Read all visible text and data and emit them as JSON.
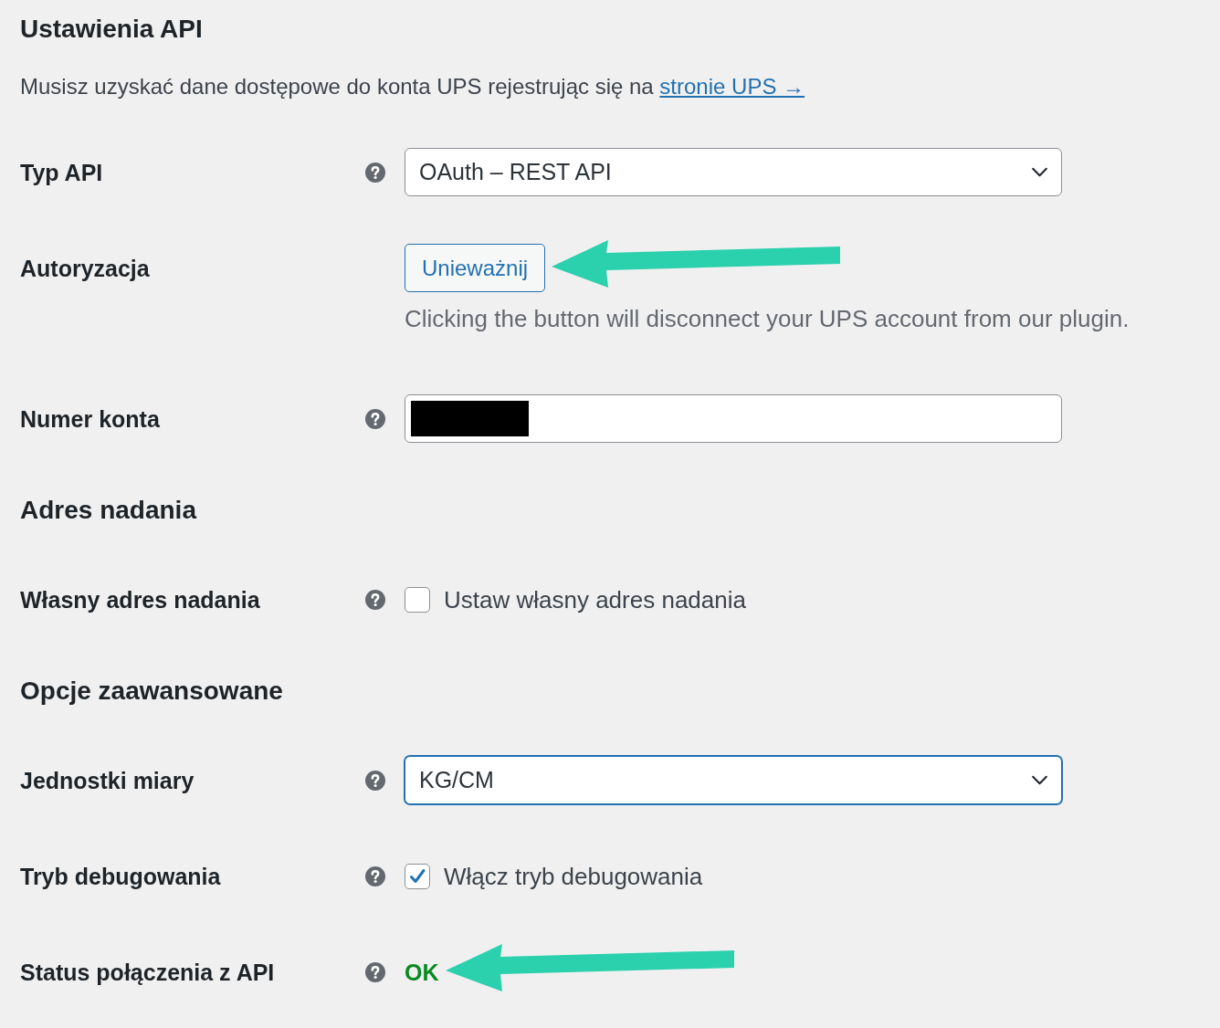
{
  "page_title": "Ustawienia API",
  "intro": {
    "text": "Musisz uzyskać dane dostępowe do konta UPS rejestrując się na",
    "link": "stronie UPS →"
  },
  "rows": [
    {
      "kind": "select",
      "label": "Typ API",
      "help": true,
      "value": "OAuth – REST API",
      "focused": false,
      "pointer_arrow": false
    },
    {
      "kind": "button",
      "label": "Autoryzacja",
      "help": false,
      "button": "Unieważnij",
      "description": "Clicking the button will disconnect your UPS account from our plugin.",
      "pointer_arrow": true
    },
    {
      "kind": "text",
      "label": "Numer konta",
      "help": true,
      "value_redacted": true,
      "pointer_arrow": false
    },
    {
      "kind": "heading",
      "text": "Adres nadania"
    },
    {
      "kind": "checkbox",
      "label": "Własny adres nadania",
      "help": true,
      "checked": false,
      "text": "Ustaw własny adres nadania",
      "pointer_arrow": false
    },
    {
      "kind": "heading",
      "text": "Opcje zaawansowane"
    },
    {
      "kind": "select",
      "label": "Jednostki miary",
      "help": true,
      "value": "KG/CM",
      "focused": true,
      "pointer_arrow": false
    },
    {
      "kind": "checkbox",
      "label": "Tryb debugowania",
      "help": true,
      "checked": true,
      "text": "Włącz tryb debugowania",
      "pointer_arrow": false
    },
    {
      "kind": "status",
      "label": "Status połączenia z API",
      "help": true,
      "status": "OK",
      "success": true,
      "pointer_arrow": true
    }
  ]
}
